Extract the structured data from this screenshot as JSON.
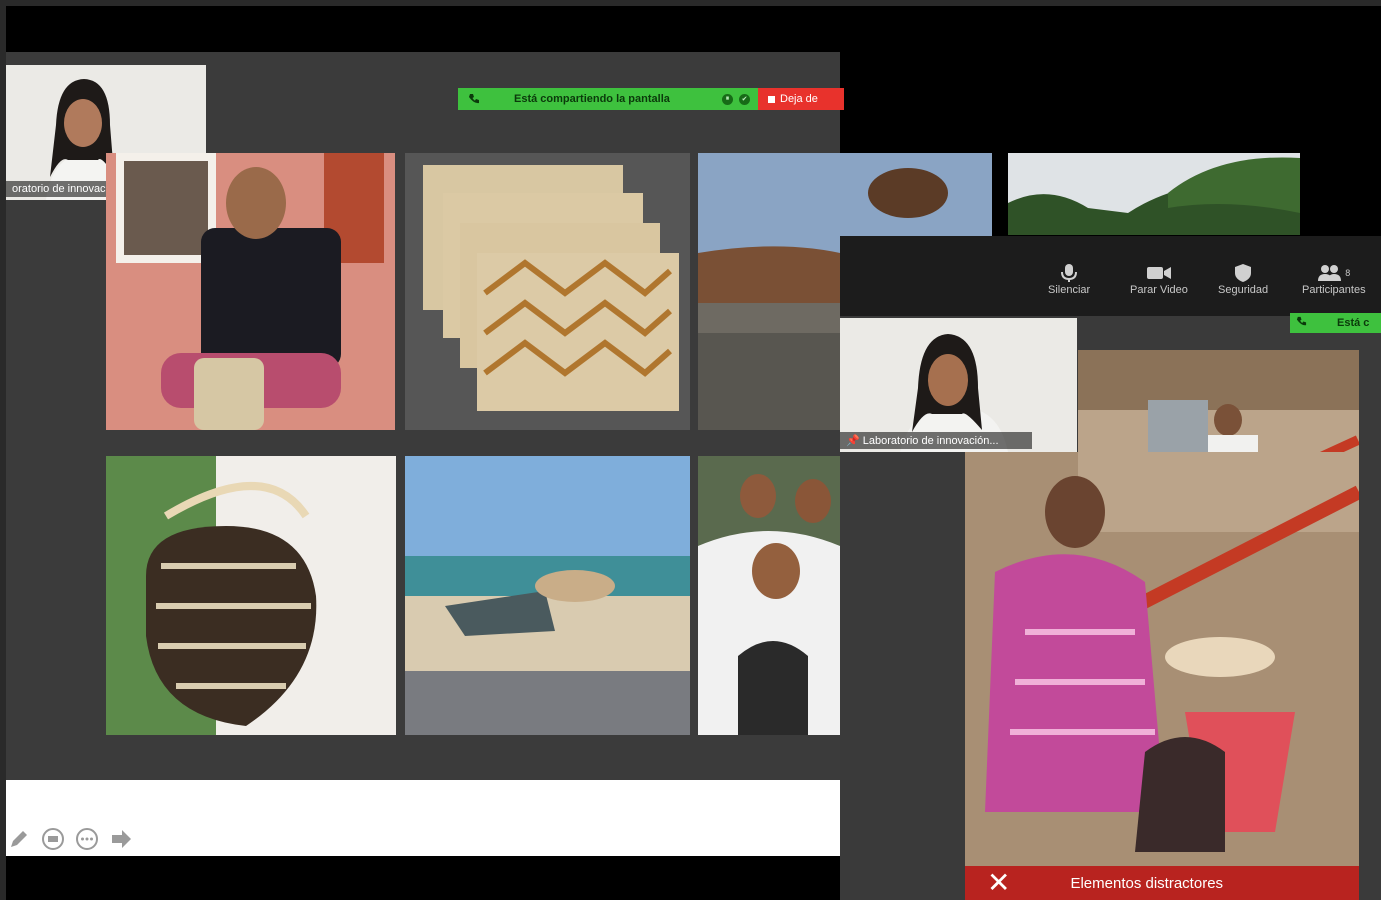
{
  "share_bar": {
    "sharing_text": "Está compartiendo la pantalla",
    "stop_text": "Deja de"
  },
  "cam_main": {
    "label": "oratorio de innovación..."
  },
  "cam_second": {
    "label": "Laboratorio de innovación..."
  },
  "zoom_toolbar": {
    "mute": "Silenciar",
    "stop_video": "Parar Video",
    "security": "Seguridad",
    "participants": "Participantes",
    "participants_count": "8"
  },
  "share_bar_second": {
    "sharing_text": "Está c"
  },
  "banner": {
    "text": "Elementos distractores"
  },
  "colors": {
    "share_green": "#3ec13e",
    "share_red": "#e8322c",
    "banner_red": "#b8231f"
  }
}
